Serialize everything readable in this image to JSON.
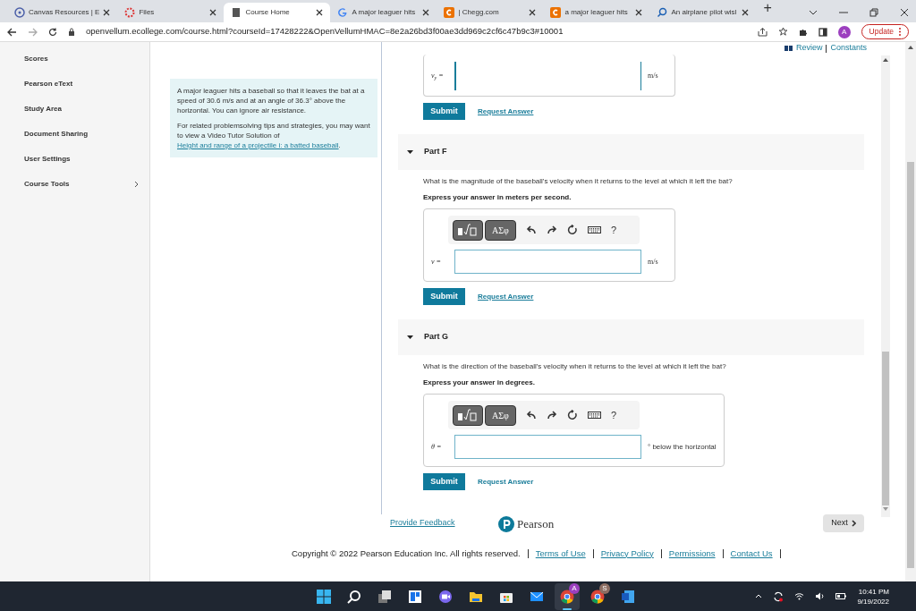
{
  "browser": {
    "tabs": [
      {
        "title": "Canvas Resources | E",
        "kind": "canvas",
        "selected": false
      },
      {
        "title": "Files",
        "kind": "files",
        "selected": false
      },
      {
        "title": "Course Home",
        "kind": "page",
        "selected": true
      },
      {
        "title": "A major leaguer hits",
        "kind": "google",
        "selected": false
      },
      {
        "title": "| Chegg.com",
        "kind": "chegg",
        "selected": false
      },
      {
        "title": "a major leaguer hits",
        "kind": "chegg",
        "selected": false
      },
      {
        "title": "An airplane pilot wisl",
        "kind": "search",
        "selected": false
      }
    ],
    "new_tab": "+",
    "address": "openvellum.ecollege.com/course.html?courseId=17428222&OpenVellumHMAC=8e2a26bd3f00ae3dd969c2cf6c47b9c3#10001",
    "profile": "A",
    "update_button": "Update"
  },
  "sidebar": {
    "items": [
      {
        "label": "Scores",
        "expandable": false
      },
      {
        "label": "Pearson eText",
        "expandable": false
      },
      {
        "label": "Study Area",
        "expandable": false
      },
      {
        "label": "Document Sharing",
        "expandable": false
      },
      {
        "label": "User Settings",
        "expandable": false
      },
      {
        "label": "Course Tools",
        "expandable": true
      }
    ]
  },
  "header_links": [
    "Review",
    "Constants"
  ],
  "problem": {
    "text": "A major leaguer hits a baseball so that it leaves the bat at a speed of 30.6 m/s and at an angle of 36.3° above the horizontal. You can ignore air resistance.",
    "tip_text": "For related problemsolving tips and strategies, you may want to view a Video Tutor Solution of",
    "tip_link": "Height and range of a projectile i: a batted baseball",
    "tip_end": "."
  },
  "parts": [
    {
      "answer": {
        "label": "v$_{y}$ =",
        "unit": "m/s",
        "focused": true
      },
      "submit": "Submit",
      "request_answer": "Request Answer",
      "underlined": true
    },
    {
      "title": "Part F",
      "expanded": true,
      "question": "What is the magnitude of the baseball's velocity when it returns to the level at which it left the bat?",
      "instruction": "Express your answer in meters per second.",
      "toolbar": {
        "symbols": "ΑΣφ",
        "help": "?"
      },
      "answer": {
        "label": "v =",
        "unit": "m/s",
        "focused": false
      },
      "submit": "Submit",
      "request_answer": "Request Answer",
      "underlined": true
    },
    {
      "title": "Part G",
      "expanded": true,
      "question": "What is the direction of the baseball's velocity when it returns to the level at which it left the bat?",
      "instruction": "Express your answer in degrees.",
      "toolbar": {
        "symbols": "ΑΣφ",
        "help": "?"
      },
      "answer": {
        "label": "θ =",
        "unit": "° below the horizontal",
        "focused": false
      },
      "submit": "Submit",
      "request_answer": "Request Answer",
      "underlined": false
    }
  ],
  "provide_feedback": "Provide Feedback",
  "next_button": "Next",
  "logo": "Pearson",
  "footer": {
    "copyright": "Copyright © 2022 Pearson Education Inc. All rights reserved.",
    "links": [
      "Terms of Use",
      "Privacy Policy",
      "Permissions",
      "Contact Us"
    ]
  },
  "taskbar": {
    "apps": [
      {
        "kind": "start",
        "active": false
      },
      {
        "kind": "search",
        "active": false
      },
      {
        "kind": "taskview",
        "active": false
      },
      {
        "kind": "widgets",
        "active": false
      },
      {
        "kind": "chat",
        "active": false
      },
      {
        "kind": "folder",
        "active": false
      },
      {
        "kind": "store",
        "active": false
      },
      {
        "kind": "mail",
        "active": false
      },
      {
        "kind": "chrome",
        "badge": "A",
        "active": true
      },
      {
        "kind": "chrome",
        "badge": "S",
        "active": false
      },
      {
        "kind": "word",
        "active": false
      }
    ],
    "time": "10:41 PM",
    "date": "9/19/2022"
  }
}
